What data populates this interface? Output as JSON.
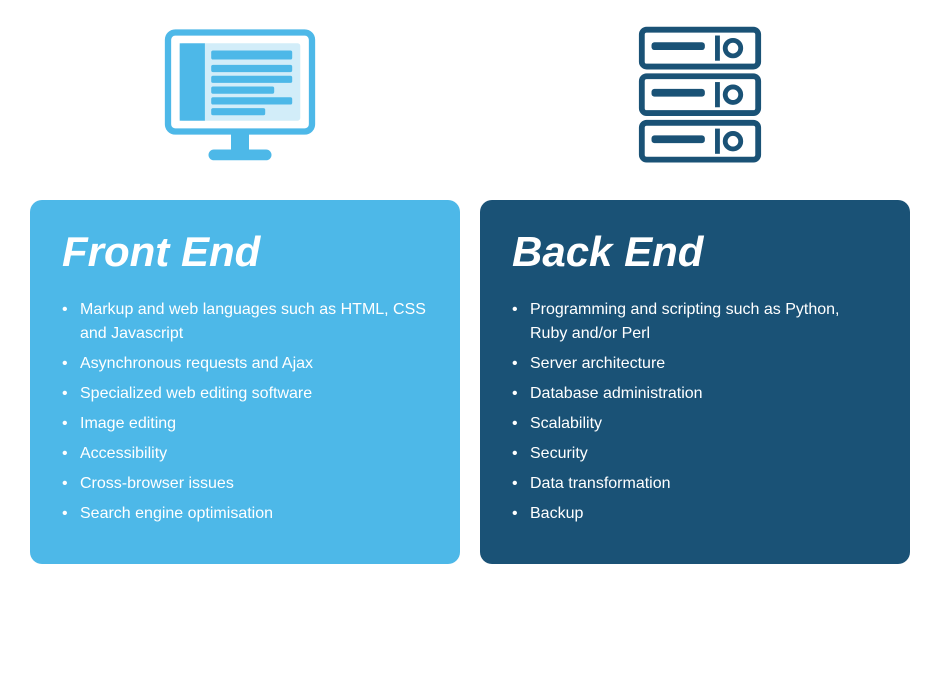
{
  "front_end": {
    "title": "Front End",
    "items": [
      "Markup and web languages such as HTML, CSS and Javascript",
      "Asynchronous requests and Ajax",
      "Specialized web editing software",
      "Image editing",
      "Accessibility",
      "Cross-browser issues",
      "Search engine optimisation"
    ]
  },
  "back_end": {
    "title": "Back End",
    "items": [
      "Programming and scripting such as Python, Ruby and/or Perl",
      "Server architecture",
      "Database administration",
      "Scalability",
      "Security",
      "Data transformation",
      "Backup"
    ]
  },
  "monitor_icon_label": "monitor-icon",
  "server_icon_label": "server-icon"
}
